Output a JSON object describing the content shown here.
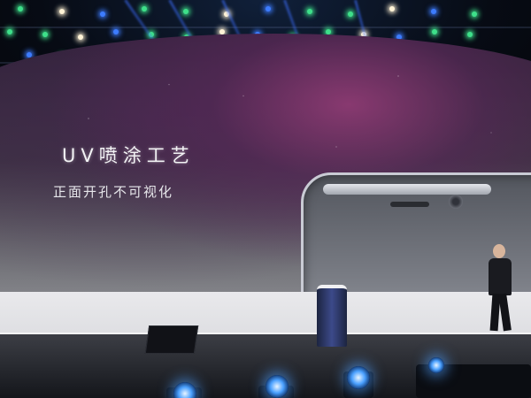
{
  "slide": {
    "title": "UV喷涂工艺",
    "subtitle": "正面开孔不可视化"
  },
  "colors": {
    "screen_purple": "#8a3c78",
    "stage_white": "#e9e9ec",
    "light_green": "#3ee08a",
    "light_blue": "#3d7cff",
    "light_white": "#fff3d6"
  }
}
